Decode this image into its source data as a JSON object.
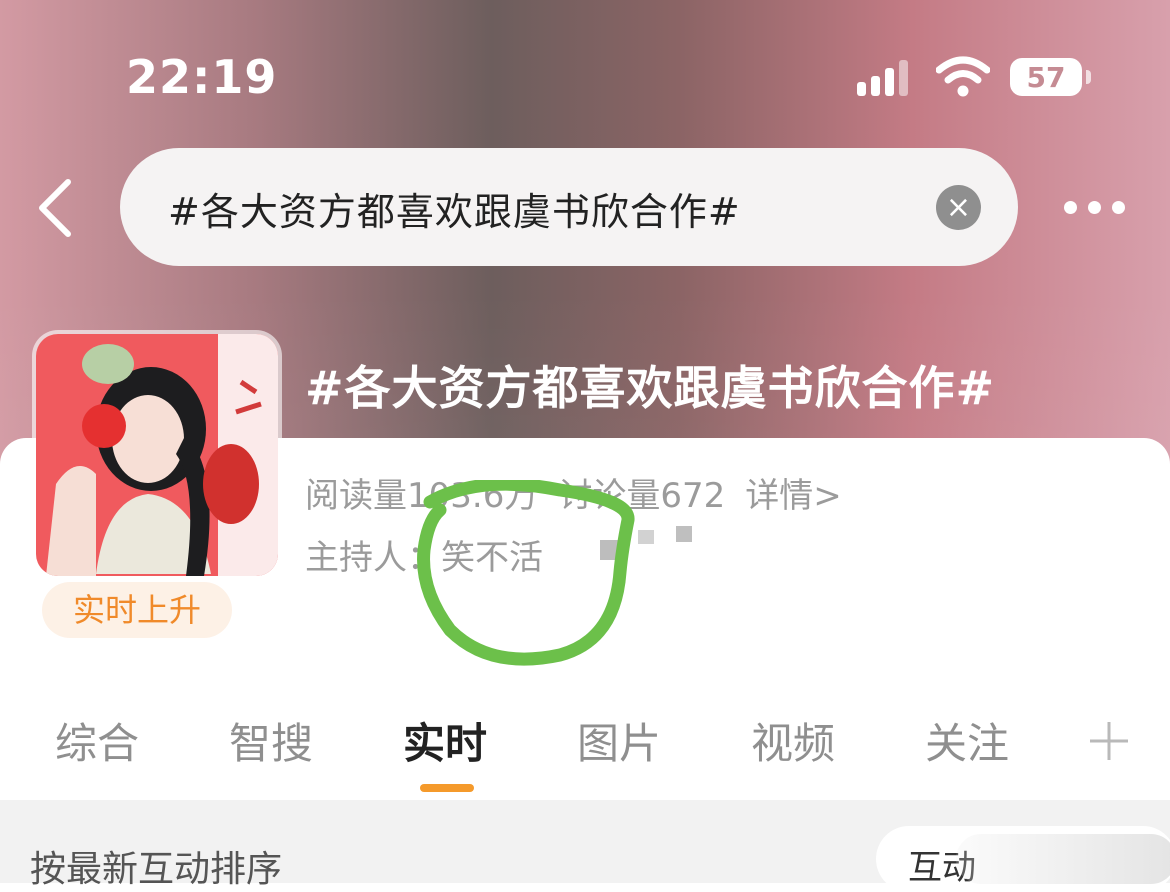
{
  "status_bar": {
    "time": "22:19",
    "battery": "57",
    "icons": [
      "signal-icon",
      "wifi-icon",
      "battery-icon"
    ]
  },
  "search": {
    "query": "#各大资方都喜欢跟虞书欣合作#",
    "clear_icon": "close-icon"
  },
  "topic": {
    "title": "#各大资方都喜欢跟虞书欣合作#",
    "read_count": "阅读量103.6万",
    "discussion_count": "讨论量672",
    "details_link": "详情>",
    "host": "主持人：笑不活",
    "badge": "实时上升"
  },
  "tabs": [
    {
      "label": "综合"
    },
    {
      "label": "智搜"
    },
    {
      "label": "实时"
    },
    {
      "label": "图片"
    },
    {
      "label": "视频"
    },
    {
      "label": "关注"
    }
  ],
  "active_tab": "实时",
  "sort": {
    "label": "按最新互动排序",
    "pill_label": "互动"
  },
  "colors": {
    "accent": "#f59a2b",
    "annotation_circle": "#6cc04a"
  }
}
